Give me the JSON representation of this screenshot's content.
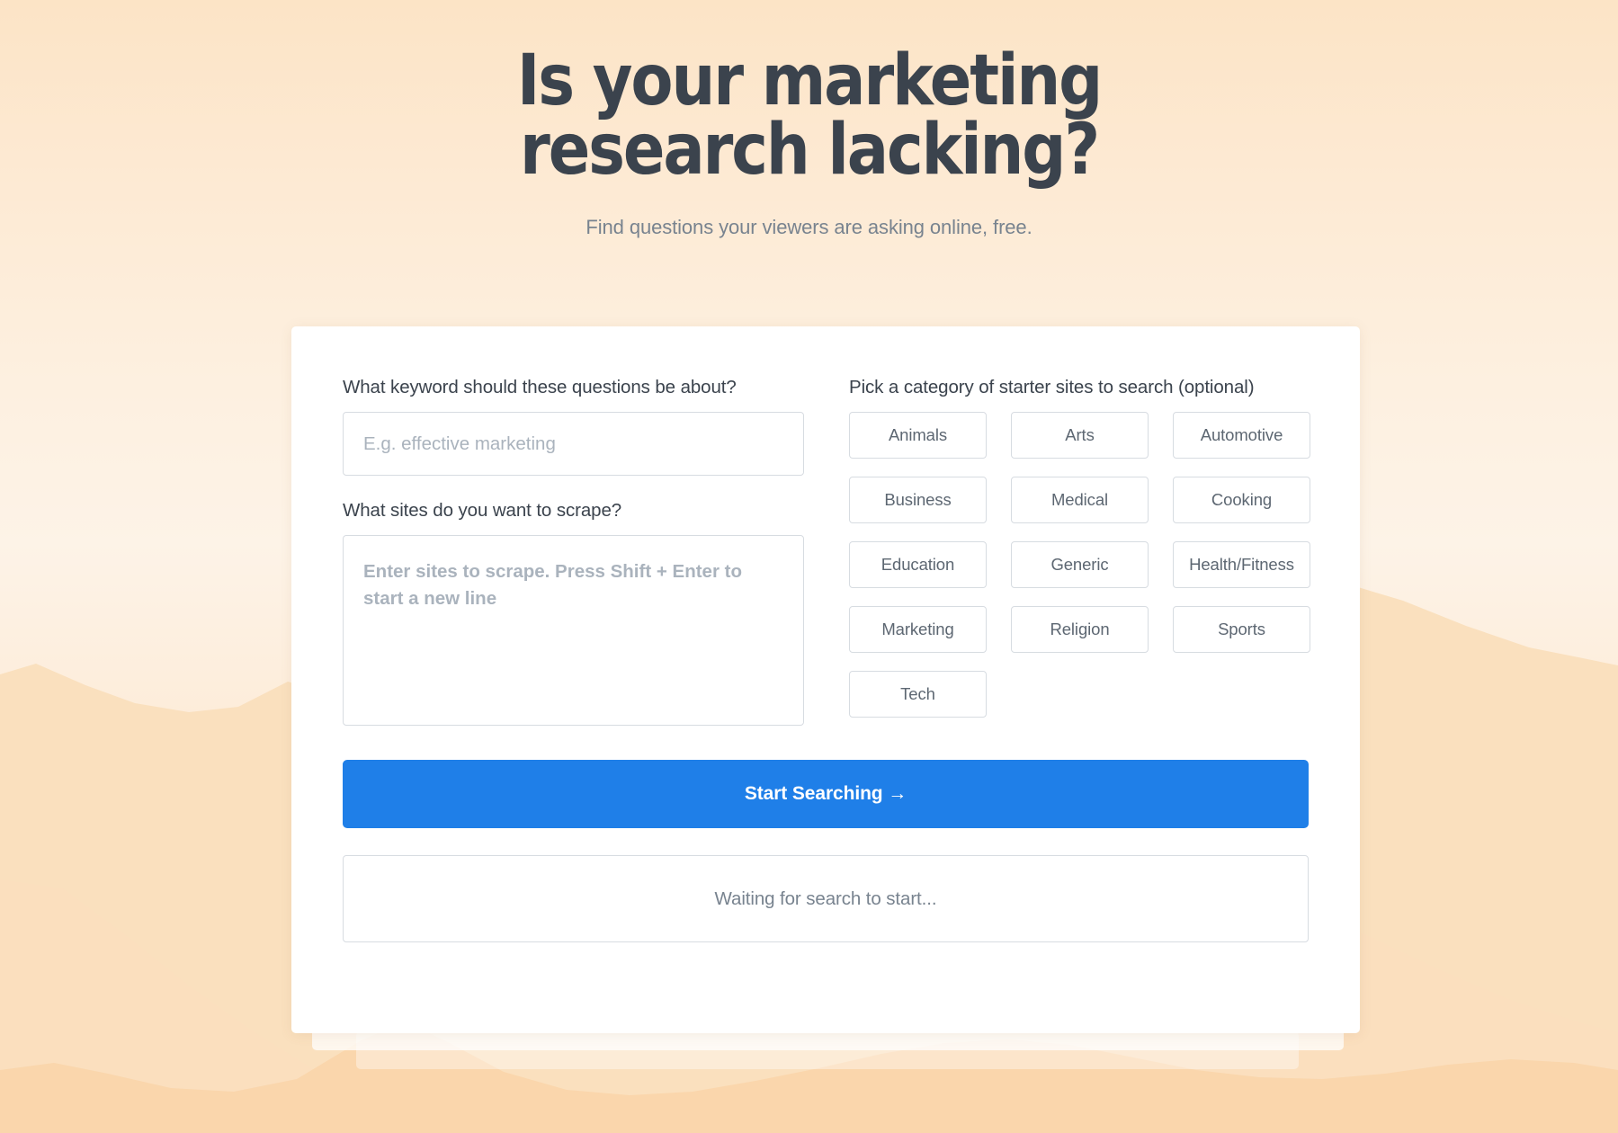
{
  "hero": {
    "headline_line1": "Is your marketing",
    "headline_line2": "research lacking?",
    "subtitle": "Find questions your viewers are asking online, free."
  },
  "form": {
    "keyword": {
      "label": "What keyword should these questions be about?",
      "value": "",
      "placeholder": "E.g. effective marketing"
    },
    "sites": {
      "label": "What sites do you want to scrape?",
      "value": "",
      "placeholder": "Enter sites to scrape. Press Shift + Enter to start a new line"
    },
    "categories": {
      "label": "Pick a category of starter sites to search (optional)",
      "items": [
        "Animals",
        "Arts",
        "Automotive",
        "Business",
        "Medical",
        "Cooking",
        "Education",
        "Generic",
        "Health/Fitness",
        "Marketing",
        "Religion",
        "Sports",
        "Tech"
      ]
    },
    "submit_label": "Start Searching →"
  },
  "status": {
    "message": "Waiting for search to start..."
  },
  "colors": {
    "accent": "#1f7fe8",
    "heading": "#3b434d",
    "muted_text": "#78838f",
    "placeholder": "#aab3bd",
    "border": "#d7dce1",
    "background_top": "#fce4c6",
    "background_bottom": "#f9d8b2",
    "card": "#ffffff"
  }
}
